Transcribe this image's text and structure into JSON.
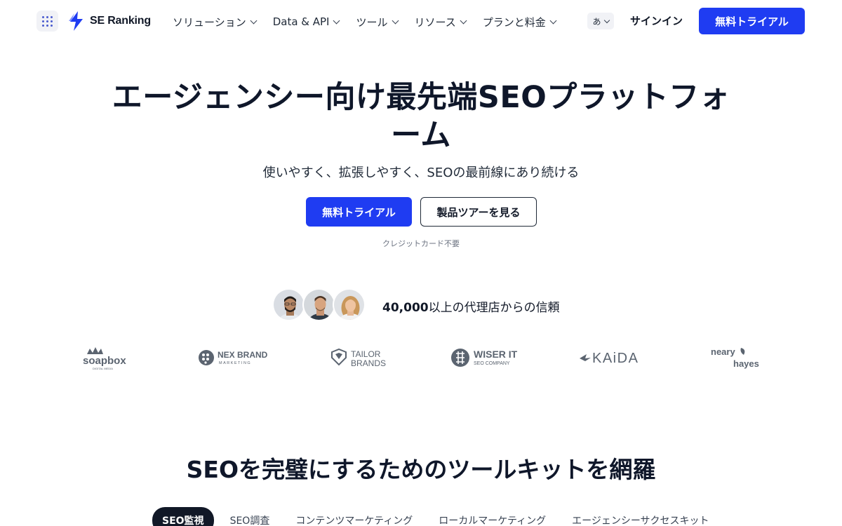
{
  "brand": {
    "name": "SE Ranking",
    "color": "#1f3cf2"
  },
  "icons": [
    "apps-grid-icon",
    "se-ranking-logo-icon",
    "chevron-down-icon"
  ],
  "nav": {
    "items": [
      {
        "label": "ソリューション"
      },
      {
        "label": "Data & API"
      },
      {
        "label": "ツール"
      },
      {
        "label": "リソース"
      },
      {
        "label": "プランと料金"
      }
    ],
    "language": "あ",
    "signin": "サインイン",
    "trial": "無料トライアル"
  },
  "hero": {
    "title": "エージェンシー向け最先端SEOプラットフォーム",
    "subtitle": "使いやすく、拡張しやすく、SEOの最前線にあり続ける",
    "primary_cta": "無料トライアル",
    "secondary_cta": "製品ツアーを見る",
    "note": "クレジットカード不要"
  },
  "trust": {
    "count": "40,000",
    "text": "以上の代理店からの信頼"
  },
  "client_logos": {
    "soapbox": {
      "name": "soapbox",
      "tag": "DIGITAL MEDIA"
    },
    "nexbrand": {
      "name": "NEX BRAND",
      "tag": "MARKETING"
    },
    "tailor": {
      "line1": "TAILOR",
      "line2": "BRANDS"
    },
    "wiser": {
      "line1": "WISER IT",
      "line2": "SEO COMPANY"
    },
    "kaida": {
      "name": "KAiDA"
    },
    "neary": {
      "line1": "neary",
      "line2": "hayes"
    }
  },
  "toolkit": {
    "title": "SEOを完璧にするためのツールキットを網羅",
    "tabs": [
      {
        "label": "SEO監視",
        "active": true
      },
      {
        "label": "SEO調査",
        "active": false
      },
      {
        "label": "コンテンツマーケティング",
        "active": false
      },
      {
        "label": "ローカルマーケティング",
        "active": false
      },
      {
        "label": "エージェンシーサクセスキット",
        "active": false
      }
    ]
  }
}
